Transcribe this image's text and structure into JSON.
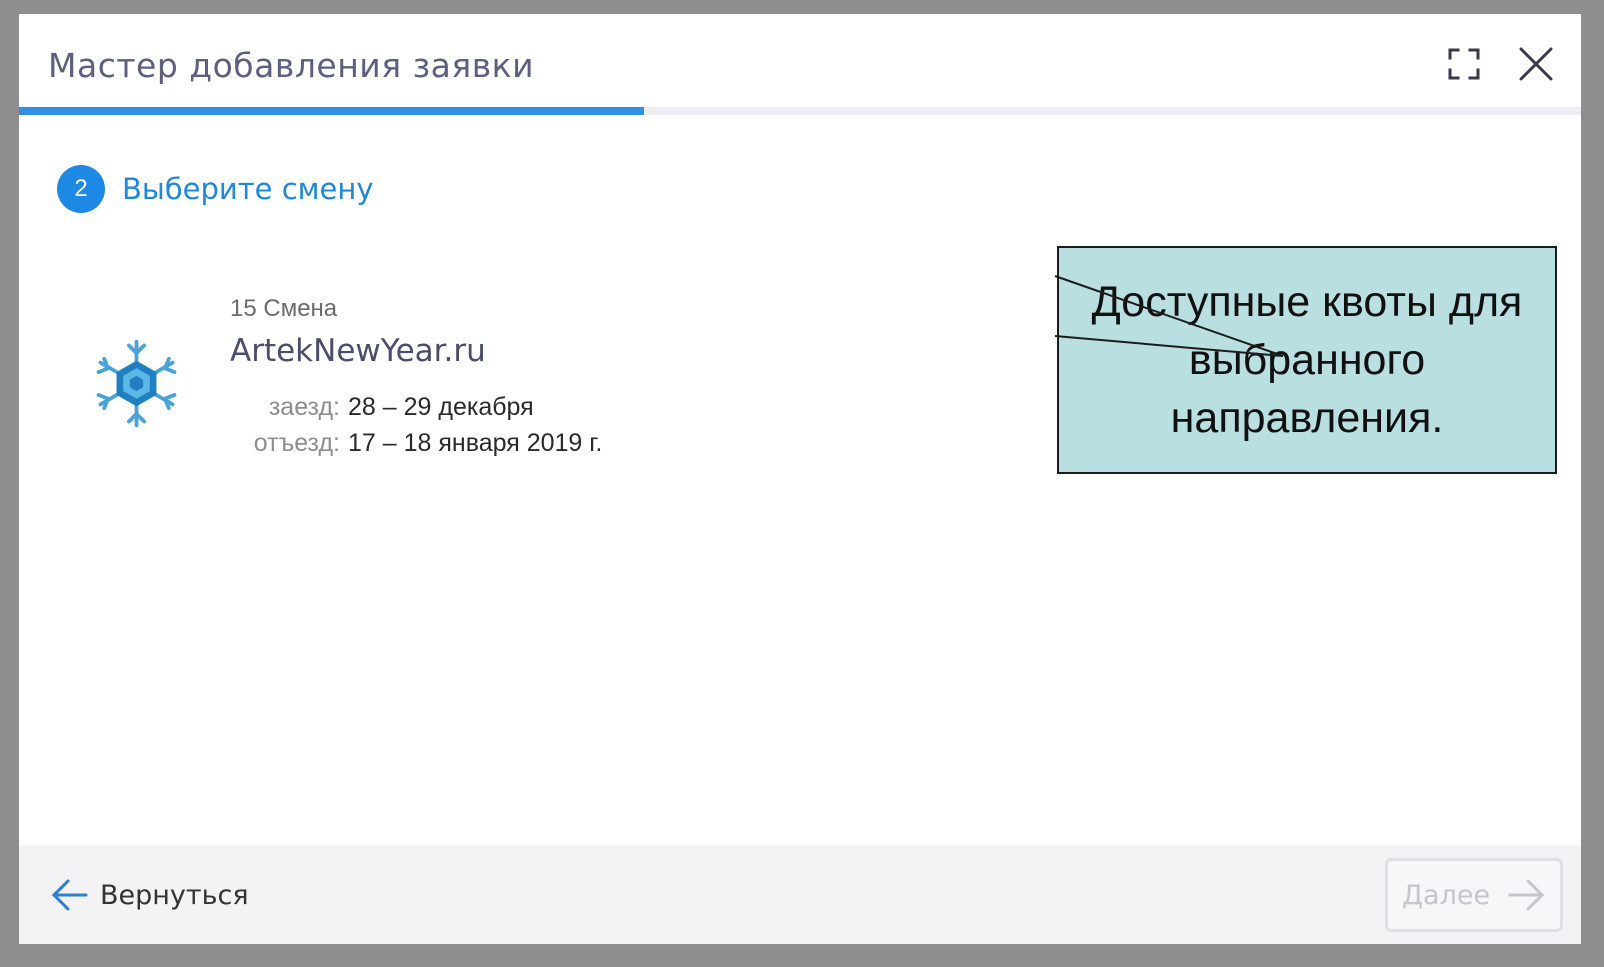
{
  "modal": {
    "title": "Мастер добавления заявки",
    "progress_fraction": 0.4,
    "accent_color": "#2e8fe3"
  },
  "step": {
    "number": "2",
    "label": "Выберите смену"
  },
  "shift": {
    "number_label": "15 Смена",
    "name": "ArtekNewYear.ru",
    "arrival_key": "заезд:",
    "arrival_value": "28 – 29 декабря",
    "departure_key": "отъезд:",
    "departure_value": "17 – 18 января 2019 г.",
    "icon": "snowflake-icon"
  },
  "callout": {
    "text": "Доступные квоты для выбранного направления."
  },
  "footer": {
    "back_label": "Вернуться",
    "next_label": "Далее"
  }
}
